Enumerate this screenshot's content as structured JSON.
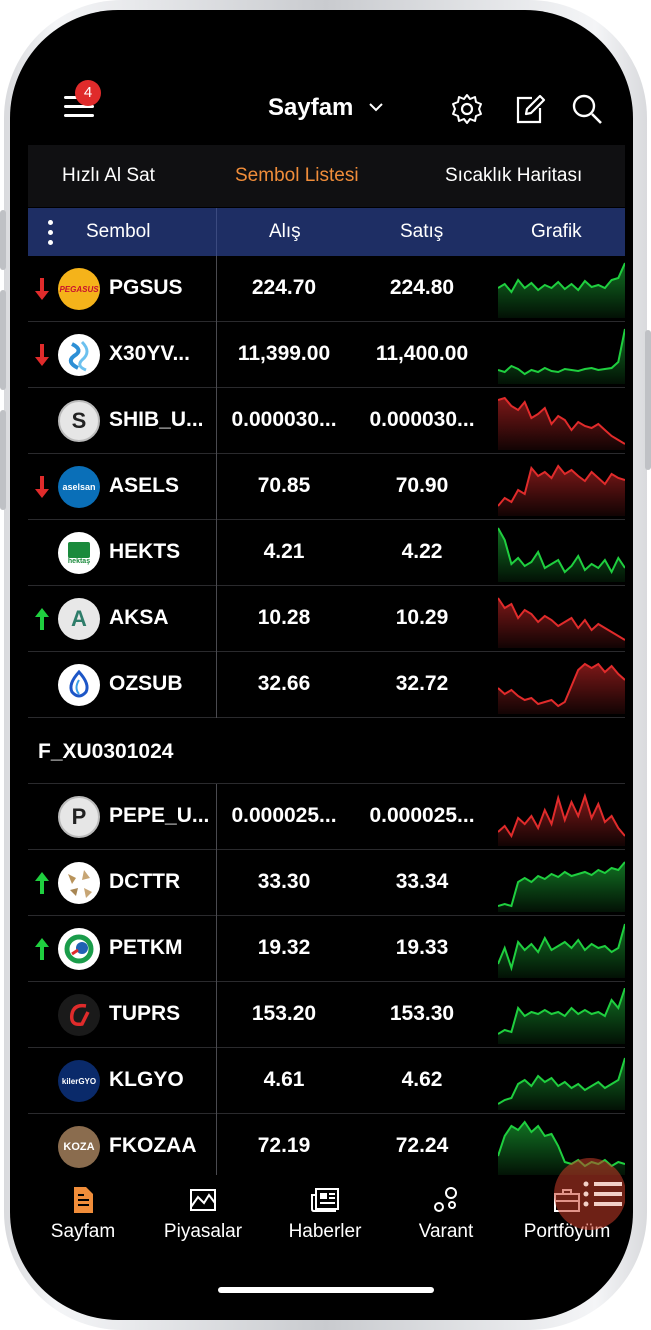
{
  "header": {
    "title": "Sayfam",
    "menu_badge": "4"
  },
  "tabs": [
    {
      "label": "Hızlı Al Sat",
      "active": false
    },
    {
      "label": "Sembol Listesi",
      "active": true
    },
    {
      "label": "Sıcaklık Haritası",
      "active": false
    }
  ],
  "columns": {
    "symbol": "Sembol",
    "bid": "Alış",
    "ask": "Satış",
    "chart": "Grafik"
  },
  "rows": [
    {
      "symbol": "PGSUS",
      "bid": "224.70",
      "ask": "224.80",
      "arrow": "down",
      "logo": "pegasus-logo",
      "logo_text": "PEGASUS",
      "trend": "up",
      "series": [
        30,
        34,
        26,
        38,
        30,
        35,
        28,
        33,
        30,
        36,
        29,
        34,
        28,
        37,
        31,
        33,
        30,
        38,
        40,
        55
      ]
    },
    {
      "symbol": "X30YV...",
      "bid": "11,399.00",
      "ask": "11,400.00",
      "arrow": "down",
      "logo": "x30-logo",
      "logo_text": "",
      "trend": "up",
      "series": [
        14,
        12,
        18,
        15,
        10,
        14,
        12,
        16,
        13,
        12,
        15,
        14,
        13,
        15,
        16,
        14,
        15,
        16,
        22,
        55
      ]
    },
    {
      "symbol": "SHIB_U...",
      "bid": "0.000030...",
      "ask": "0.000030...",
      "arrow": "",
      "logo": "s-logo",
      "logo_text": "S",
      "trend": "down",
      "series": [
        50,
        52,
        44,
        40,
        48,
        32,
        36,
        42,
        26,
        34,
        30,
        20,
        28,
        24,
        22,
        26,
        20,
        14,
        10,
        6
      ]
    },
    {
      "symbol": "ASELS",
      "bid": "70.85",
      "ask": "70.90",
      "arrow": "down",
      "logo": "aselsan-logo",
      "logo_text": "aselsan",
      "trend": "down",
      "series": [
        10,
        18,
        14,
        26,
        22,
        48,
        40,
        44,
        38,
        50,
        42,
        46,
        40,
        35,
        44,
        38,
        32,
        42,
        38,
        36
      ]
    },
    {
      "symbol": "HEKTS",
      "bid": "4.21",
      "ask": "4.22",
      "arrow": "",
      "logo": "hektas-logo",
      "logo_text": "hektaş",
      "trend": "up",
      "series": [
        54,
        42,
        18,
        24,
        16,
        20,
        30,
        14,
        18,
        22,
        10,
        16,
        26,
        12,
        18,
        14,
        22,
        10,
        24,
        14
      ]
    },
    {
      "symbol": "AKSA",
      "bid": "10.28",
      "ask": "10.29",
      "arrow": "up",
      "logo": "aksa-logo",
      "logo_text": "A",
      "trend": "down",
      "series": [
        50,
        40,
        44,
        30,
        38,
        34,
        26,
        32,
        28,
        22,
        26,
        30,
        20,
        28,
        18,
        24,
        20,
        16,
        12,
        8
      ]
    },
    {
      "symbol": "OZSUB",
      "bid": "32.66",
      "ask": "32.72",
      "arrow": "",
      "logo": "ozsub-logo",
      "logo_text": "",
      "trend": "down",
      "series": [
        26,
        20,
        24,
        18,
        14,
        16,
        10,
        12,
        14,
        8,
        12,
        28,
        44,
        50,
        46,
        50,
        42,
        48,
        40,
        34
      ]
    }
  ],
  "group_label": "F_XU0301024",
  "rows2": [
    {
      "symbol": "PEPE_U...",
      "bid": "0.000025...",
      "ask": "0.000025...",
      "arrow": "",
      "logo": "p-logo",
      "logo_text": "P",
      "trend": "down",
      "series": [
        14,
        20,
        10,
        28,
        22,
        30,
        18,
        36,
        22,
        48,
        26,
        44,
        30,
        50,
        28,
        42,
        24,
        30,
        18,
        10
      ]
    },
    {
      "symbol": "DCTTR",
      "bid": "33.30",
      "ask": "33.34",
      "arrow": "up",
      "logo": "dcttr-logo",
      "logo_text": "",
      "trend": "up",
      "series": [
        6,
        8,
        6,
        30,
        34,
        30,
        36,
        33,
        38,
        35,
        40,
        36,
        38,
        40,
        37,
        42,
        39,
        44,
        42,
        50
      ]
    },
    {
      "symbol": "PETKM",
      "bid": "19.32",
      "ask": "19.33",
      "arrow": "up",
      "logo": "petkm-logo",
      "logo_text": "",
      "trend": "up",
      "series": [
        14,
        30,
        10,
        36,
        28,
        34,
        26,
        40,
        28,
        32,
        36,
        30,
        38,
        28,
        34,
        30,
        32,
        26,
        30,
        54
      ]
    },
    {
      "symbol": "TUPRS",
      "bid": "153.20",
      "ask": "153.30",
      "arrow": "",
      "logo": "tuprs-logo",
      "logo_text": "",
      "trend": "up",
      "series": [
        10,
        14,
        12,
        36,
        28,
        32,
        30,
        34,
        30,
        32,
        28,
        36,
        30,
        34,
        30,
        32,
        28,
        44,
        36,
        56
      ]
    },
    {
      "symbol": "KLGYO",
      "bid": "4.61",
      "ask": "4.62",
      "arrow": "",
      "logo": "kiler-logo",
      "logo_text": "kilerGYO",
      "trend": "up",
      "series": [
        6,
        10,
        12,
        26,
        30,
        24,
        34,
        28,
        32,
        24,
        28,
        22,
        26,
        20,
        24,
        28,
        22,
        26,
        30,
        52
      ]
    },
    {
      "symbol": "FKOZAA",
      "bid": "72.19",
      "ask": "72.24",
      "arrow": "",
      "logo": "koza-logo",
      "logo_text": "KOZA",
      "trend": "up",
      "series": [
        20,
        40,
        50,
        46,
        54,
        44,
        50,
        40,
        42,
        30,
        14,
        12,
        16,
        10,
        14,
        12,
        16,
        10,
        14,
        12
      ]
    }
  ],
  "nav": [
    {
      "label": "Sayfam",
      "icon": "document-icon",
      "active": true
    },
    {
      "label": "Piyasalar",
      "icon": "market-icon",
      "active": false
    },
    {
      "label": "Haberler",
      "icon": "news-icon",
      "active": false
    },
    {
      "label": "Varant",
      "icon": "varant-icon",
      "active": false
    },
    {
      "label": "Portföyüm",
      "icon": "briefcase-icon",
      "active": false
    }
  ],
  "colors": {
    "accent": "#f08d3a",
    "up": "#1fcf3f",
    "down": "#e02b2b",
    "header_bg": "#1e2e64",
    "badge": "#e02b2b"
  }
}
